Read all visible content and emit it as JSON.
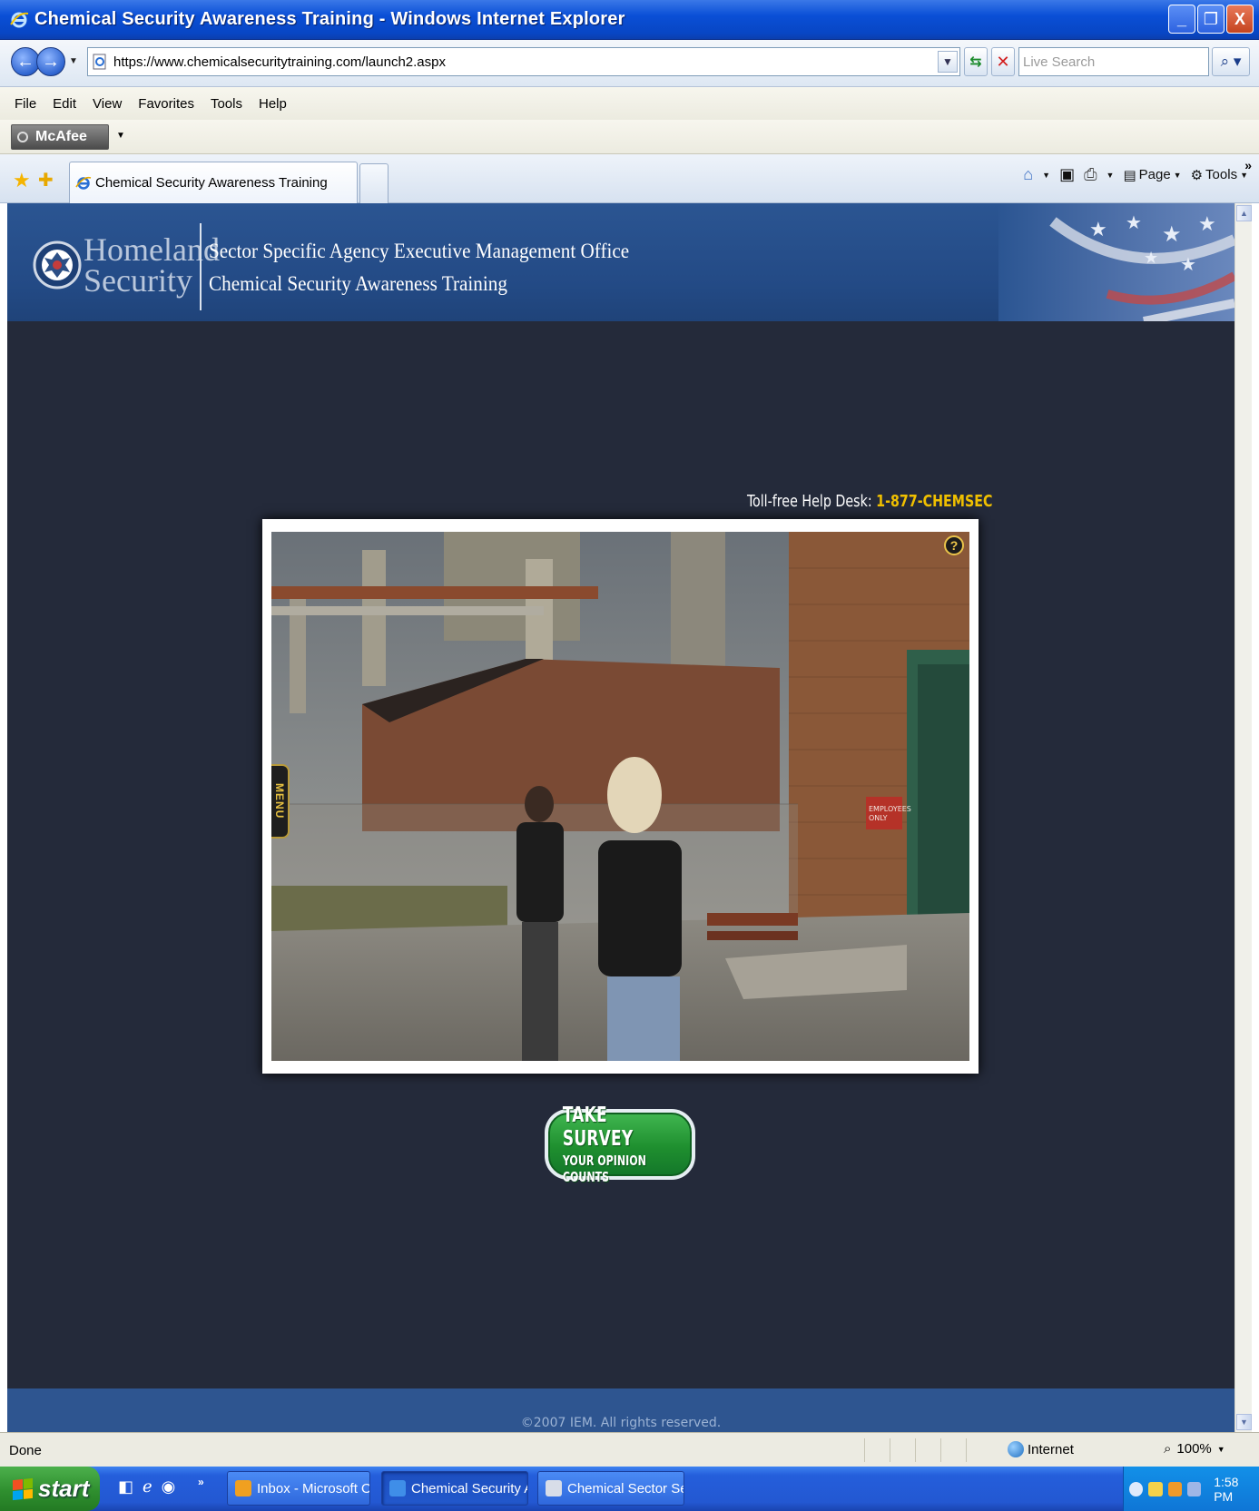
{
  "window": {
    "title": "Chemical Security Awareness Training - Windows Internet Explorer",
    "controls": {
      "minimize": "_",
      "maximize": "❐",
      "close": "X"
    }
  },
  "address_bar": {
    "url": "https://www.chemicalsecuritytraining.com/launch2.aspx",
    "search_placeholder": "Live Search"
  },
  "menu": {
    "items": [
      "File",
      "Edit",
      "View",
      "Favorites",
      "Tools",
      "Help"
    ]
  },
  "mcafee": {
    "label": "McAfee"
  },
  "tabs": {
    "active_tab": "Chemical Security Awareness Training",
    "commands": {
      "page": "Page",
      "tools": "Tools"
    }
  },
  "header": {
    "agency_line1": "Homeland",
    "agency_line2": "Security",
    "office": "Sector Specific Agency Executive Management Office",
    "course": "Chemical Security Awareness Training"
  },
  "training": {
    "helpdesk_label": "Toll-free Help Desk:",
    "helpdesk_number": "1-877-CHEMSEC",
    "menu_tab": "MENU",
    "help_button": "?",
    "sign_text": "EMPLOYEES ONLY"
  },
  "survey": {
    "line1": "TAKE SURVEY",
    "line2": "YOUR OPINION COUNTS"
  },
  "footer": {
    "copyright": "©2007 IEM. All rights reserved."
  },
  "statusbar": {
    "status": "Done",
    "zone": "Internet",
    "zoom": "100%"
  },
  "taskbar": {
    "start": "start",
    "tasks": [
      {
        "label": "Inbox - Microsoft Out...",
        "active": false
      },
      {
        "label": "Chemical Security Aw...",
        "active": true
      },
      {
        "label": "Chemical Sector Secu...",
        "active": false
      }
    ],
    "clock": "1:58 PM"
  },
  "colors": {
    "title_bar": "#0846c4",
    "page_background": "#242a3a",
    "header_background": "#2b5592",
    "helpdesk_number": "#f0c000",
    "survey_green": "#1f8f2f",
    "taskbar": "#245edb",
    "start_button": "#2f8f2f"
  }
}
